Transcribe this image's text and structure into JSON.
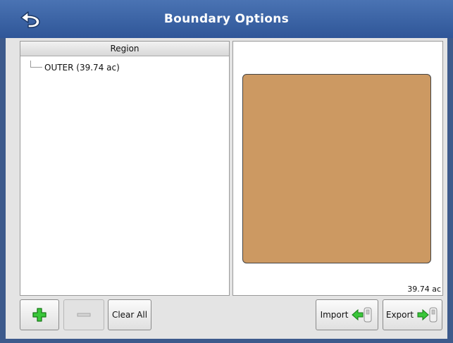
{
  "window": {
    "title": "Boundary Options"
  },
  "back": {
    "icon": "back-arrow-icon"
  },
  "region_list": {
    "header": "Region",
    "items": [
      {
        "label": "OUTER (39.74 ac)"
      }
    ]
  },
  "preview": {
    "area_label": "39.74 ac",
    "field_color": "#cc9962"
  },
  "toolbar": {
    "add_icon": "plus-icon",
    "remove_icon": "minus-icon",
    "clear_all_label": "Clear All",
    "import_label": "Import",
    "export_label": "Export"
  },
  "colors": {
    "title_bar": "#3d63a5",
    "frame": "#3d5a8c",
    "accent_green": "#2fbf2f"
  }
}
